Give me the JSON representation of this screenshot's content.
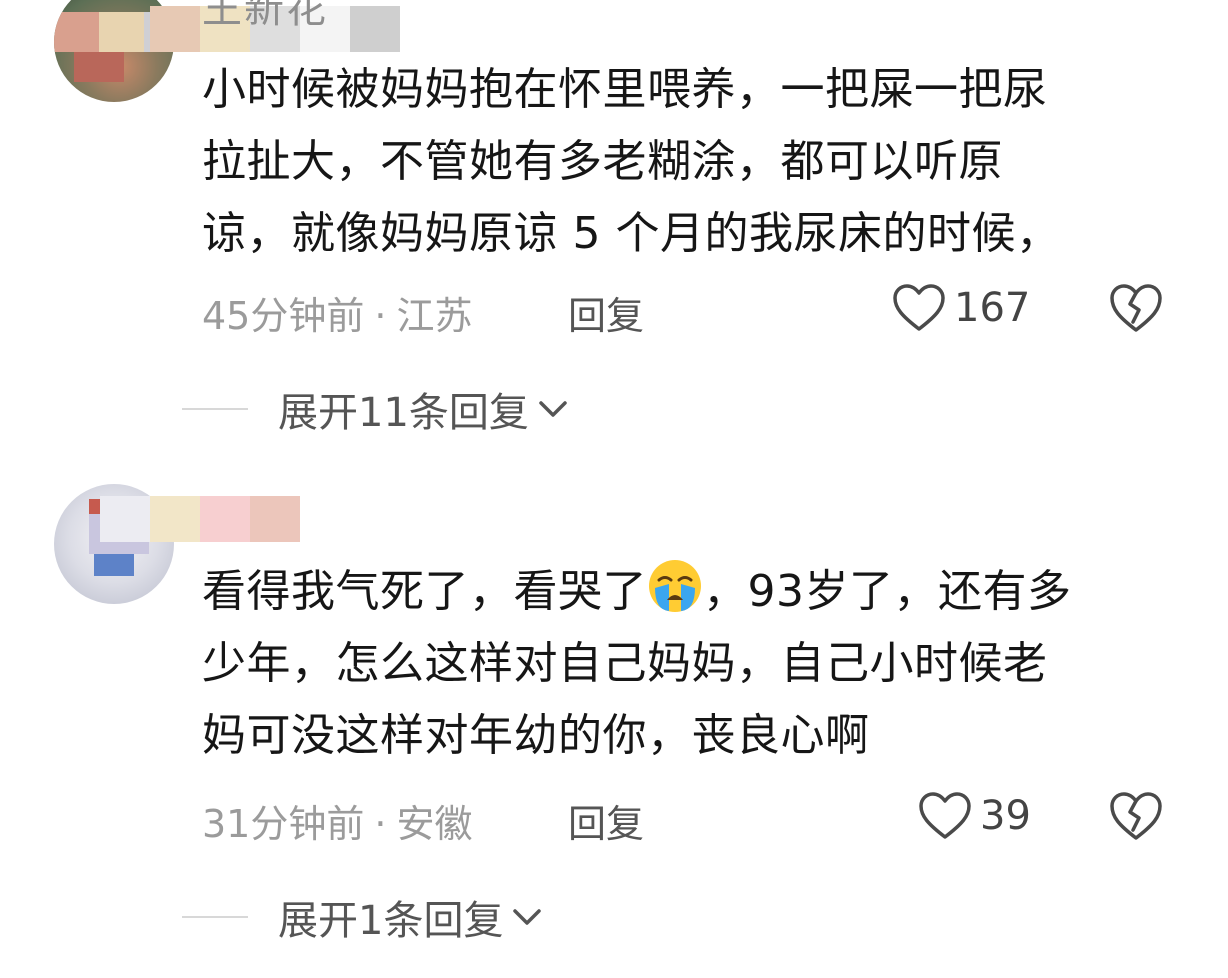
{
  "comments": [
    {
      "username": "王新花",
      "text": "小时候被妈妈抱在怀里喂养，一把屎一把尿\n拉扯大，不管她有多老糊涂，都可以听原\n谅，就像妈妈原谅 5 个月的我尿床的时候，",
      "time": "45分钟前",
      "separator": "·",
      "location": "江苏",
      "reply_label": "回复",
      "likes": "167",
      "expand_label": "展开11条回复",
      "icons": {
        "like": "heart-outline-icon",
        "dislike": "broken-heart-icon",
        "expand": "chevron-down-icon"
      }
    },
    {
      "username": "",
      "text_before_emoji": "看得我气死了，看哭了",
      "emoji": "crying-face-emoji",
      "text_after_emoji": "，93岁了，还有多\n少年，怎么这样对自己妈妈，自己小时候老\n妈可没这样对年幼的你，丧良心啊",
      "time": "31分钟前",
      "separator": "·",
      "location": "安徽",
      "reply_label": "回复",
      "likes": "39",
      "expand_label": "展开1条回复",
      "icons": {
        "like": "heart-outline-icon",
        "dislike": "broken-heart-icon",
        "expand": "chevron-down-icon"
      }
    }
  ],
  "colors": {
    "text": "#161616",
    "meta": "#9b9b9b",
    "action": "#555555",
    "divider": "#d8d8d8"
  }
}
